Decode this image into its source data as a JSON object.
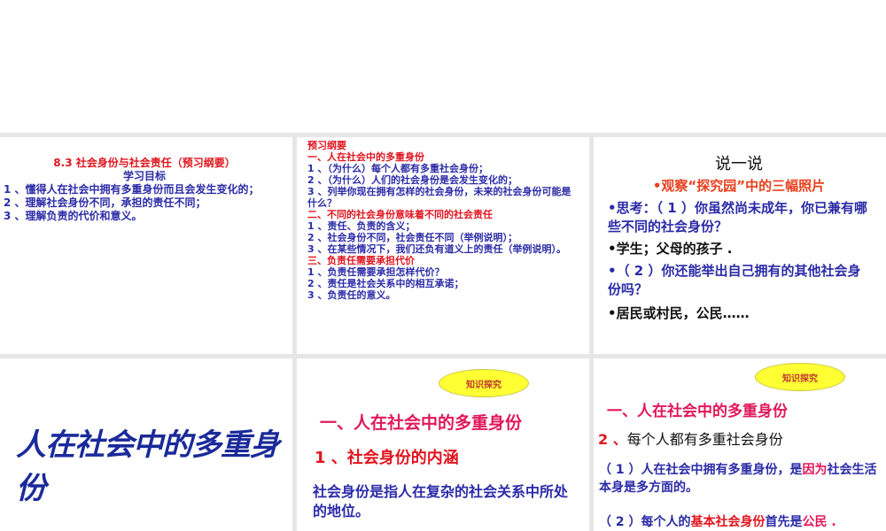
{
  "slide1": {
    "title": "8.3 社会身份与社会责任（预习纲要）",
    "subtitle": "学习目标",
    "items": [
      "1 、懂得人在社会中拥有多重身份而且会发生变化的；",
      "2 、理解社会身份不同，承担的责任不同；",
      "3 、理解负责的代价和意义。"
    ]
  },
  "slide2": {
    "heading": "预习纲要",
    "sections": [
      {
        "title": "一、人在社会中的多重身份",
        "items": [
          "1 、（为什么）每个人都有多重社会身份；",
          "2 、（为什么）人们的社会身份是会发生变化的；",
          "3 、列举你现在拥有怎样的社会身份，未来的社会身份可能是什么？"
        ]
      },
      {
        "title": "二、不同的社会身份意味着不同的社会责任",
        "items": [
          "1 、责任、负责的含义；",
          "2 、社会身份不同，社会责任不同（举例说明）；",
          "3 、在某些情况下，我们还负有道义上的责任（举例说明）。"
        ]
      },
      {
        "title": "三、负责任需要承担代价",
        "items": [
          "1 、负责任需要承担怎样代价？",
          "2 、责任是社会关系中的相互承诺；",
          "3 、负责任的意义。"
        ]
      }
    ]
  },
  "slide3": {
    "title": "说一说",
    "observe": "•观察“探究园”中的三幅照片",
    "q1": "•思考：（ 1 ）你虽然尚未成年，你已兼有哪些不同的社会身份？",
    "a1": "•学生；父母的孩子 .",
    "q2": "•（ 2 ）你还能举出自己拥有的其他社会身份吗？",
    "a2": "•居民或村民，公民……"
  },
  "slide4": {
    "title": "人在社会中的多重身份"
  },
  "slide5": {
    "badge": "知识探究",
    "heading": "一、人在社会中的多重身份",
    "sub": "1 、社会身份的内涵",
    "body": "社会身份是指人在复杂的社会关系中所处的地位。"
  },
  "slide6": {
    "badge": "知识探究",
    "heading": "一、人在社会中的多重身份",
    "sub_num": "2 、",
    "sub": "每个人都有多重社会身份",
    "p1a": "（ 1 ）人在社会中拥有多重身份，是",
    "p1b": "因为",
    "p1c": "社会生活本身是多方面的。",
    "p2a": "（ 2 ）每个人的",
    "p2b": "基本社会身份",
    "p2c": "首先是",
    "p2d": "公民 ."
  }
}
